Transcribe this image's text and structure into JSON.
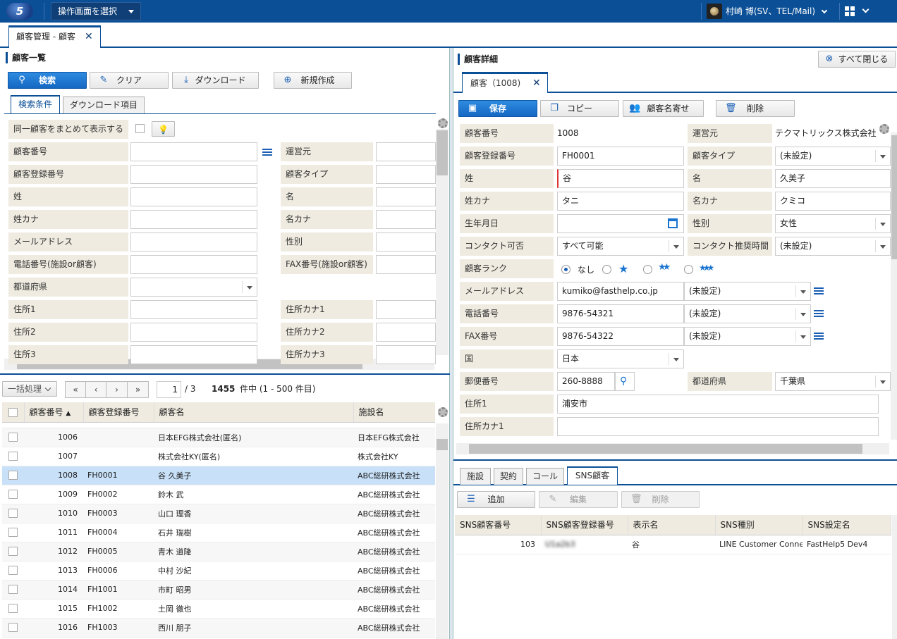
{
  "top": {
    "logo": "5",
    "screen_select": "操作画面を選択",
    "user": "村崎 博(SV、TEL/Mail)"
  },
  "main_tab": {
    "label": "顧客管理 - 顧客"
  },
  "list": {
    "title": "顧客一覧",
    "buttons": {
      "search": "検索",
      "clear": "クリア",
      "download": "ダウンロード",
      "new": "新規作成"
    },
    "tabs": {
      "criteria": "検索条件",
      "download_items": "ダウンロード項目"
    },
    "same_customer": "同一顧客をまとめて表示する",
    "fields_left": [
      "顧客番号",
      "顧客登録番号",
      "姓",
      "姓カナ",
      "メールアドレス",
      "電話番号(施設or顧客)",
      "都道府県",
      "住所1",
      "住所2",
      "住所3"
    ],
    "fields_right": [
      "運営元",
      "顧客タイプ",
      "名",
      "名カナ",
      "性別",
      "FAX番号(施設or顧客)",
      "",
      "住所カナ1",
      "住所カナ2",
      "住所カナ3"
    ],
    "bulk": "一括処理",
    "page_current": "1",
    "page_total": "/ 3",
    "count_bold": "1455",
    "count_text": "件中 (1 - 500 件目)",
    "columns": [
      "顧客番号",
      "顧客登録番号",
      "顧客名",
      "施設名"
    ],
    "rows": [
      {
        "no": "1006",
        "reg": "",
        "name": "日本EFG株式会社(匿名)",
        "facility": "日本EFG株式会社"
      },
      {
        "no": "1007",
        "reg": "",
        "name": "株式会社KY(匿名)",
        "facility": "株式会社KY"
      },
      {
        "no": "1008",
        "reg": "FH0001",
        "name": "谷 久美子",
        "facility": "ABC総研株式会社"
      },
      {
        "no": "1009",
        "reg": "FH0002",
        "name": "鈴木 武",
        "facility": "ABC総研株式会社"
      },
      {
        "no": "1010",
        "reg": "FH0003",
        "name": "山口 理香",
        "facility": "ABC総研株式会社"
      },
      {
        "no": "1011",
        "reg": "FH0004",
        "name": "石井 瑞樹",
        "facility": "ABC総研株式会社"
      },
      {
        "no": "1012",
        "reg": "FH0005",
        "name": "青木 道隆",
        "facility": "ABC総研株式会社"
      },
      {
        "no": "1013",
        "reg": "FH0006",
        "name": "中村 沙紀",
        "facility": "ABC総研株式会社"
      },
      {
        "no": "1014",
        "reg": "FH1001",
        "name": "市町 昭男",
        "facility": "ABC総研株式会社"
      },
      {
        "no": "1015",
        "reg": "FH1002",
        "name": "土岡 徹也",
        "facility": "ABC総研株式会社"
      },
      {
        "no": "1016",
        "reg": "FH1003",
        "name": "西川 朋子",
        "facility": "ABC総研株式会社"
      }
    ]
  },
  "detail": {
    "title": "顧客詳細",
    "close_all": "すべて閉じる",
    "tab": "顧客（1008)",
    "buttons": {
      "save": "保存",
      "copy": "コピー",
      "merge": "顧客名寄せ",
      "delete": "削除"
    },
    "labels": {
      "no": "顧客番号",
      "operator": "運営元",
      "reg_no": "顧客登録番号",
      "type": "顧客タイプ",
      "last": "姓",
      "first": "名",
      "last_kana": "姓カナ",
      "first_kana": "名カナ",
      "birth": "生年月日",
      "gender": "性別",
      "contact": "コンタクト可否",
      "contact_time": "コンタクト推奨時間",
      "rank": "顧客ランク",
      "email": "メールアドレス",
      "tel": "電話番号",
      "fax": "FAX番号",
      "country": "国",
      "zip": "郵便番号",
      "pref": "都道府県",
      "addr1": "住所1",
      "addr1_kana": "住所カナ1"
    },
    "values": {
      "no": "1008",
      "operator": "テクマトリックス株式会社",
      "reg_no": "FH0001",
      "type": "(未設定)",
      "last": "谷",
      "first": "久美子",
      "last_kana": "タニ",
      "first_kana": "クミコ",
      "birth": "",
      "gender": "女性",
      "contact": "すべて可能",
      "contact_time": "(未設定)",
      "rank_none": "なし",
      "email": "kumiko@fasthelp.co.jp",
      "email_type": "(未設定)",
      "tel": "9876-54321",
      "tel_type": "(未設定)",
      "fax": "9876-54322",
      "fax_type": "(未設定)",
      "country": "日本",
      "zip": "260-8888",
      "pref": "千葉県",
      "addr1": "浦安市",
      "addr1_kana": ""
    },
    "bottom_tabs": [
      "施設",
      "契約",
      "コール",
      "SNS顧客"
    ],
    "sns_buttons": {
      "add": "追加",
      "edit": "編集",
      "delete": "削除"
    },
    "sns_columns": [
      "SNS顧客番号",
      "SNS顧客登録番号",
      "表示名",
      "SNS種別",
      "SNS設定名"
    ],
    "sns_rows": [
      {
        "no": "103",
        "reg": "U1a2b3",
        "name": "谷",
        "type": "LINE Customer Connect",
        "setting": "FastHelp5 Dev4"
      }
    ]
  }
}
